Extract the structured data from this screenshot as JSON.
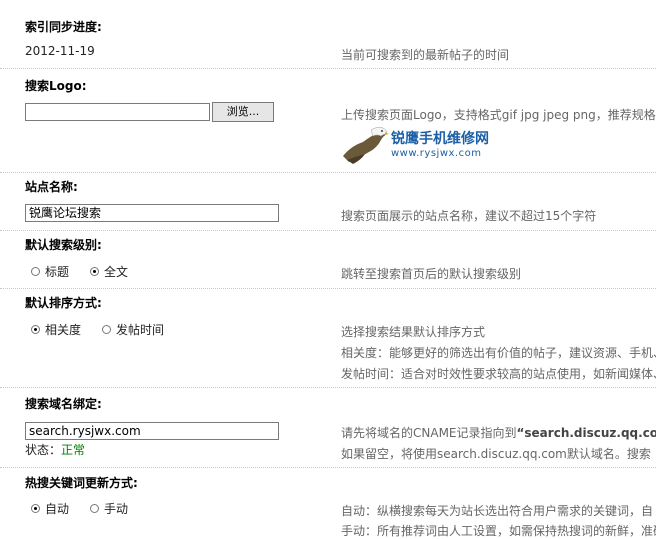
{
  "sync": {
    "title": "索引同步进度:",
    "value": "2012-11-19",
    "desc": "当前可搜索到的最新帖子的时间"
  },
  "logo": {
    "title": "搜索Logo:",
    "browse_label": "浏览...",
    "desc": "上传搜索页面Logo，支持格式gif jpg jpeg png，推荐规格",
    "logo_text": "锐鹰手机维修网",
    "logo_url": "www.rysjwx.com"
  },
  "site_name": {
    "title": "站点名称:",
    "value": "锐鹰论坛搜索",
    "desc": "搜索页面展示的站点名称，建议不超过15个字符"
  },
  "default_level": {
    "title": "默认搜索级别:",
    "options": [
      "标题",
      "全文"
    ],
    "selected": "全文",
    "desc": "跳转至搜索首页后的默认搜索级别"
  },
  "default_sort": {
    "title": "默认排序方式:",
    "options": [
      "相关度",
      "发帖时间"
    ],
    "selected": "相关度",
    "desc_lines": [
      "选择搜索结果默认排序方式",
      "相关度：能够更好的筛选出有价值的帖子，建议资源、手机、",
      "发帖时间：适合对时效性要求较高的站点使用，如新闻媒体、"
    ]
  },
  "domain_bind": {
    "title": "搜索域名绑定:",
    "value": "search.rysjwx.com",
    "status_label": "状态：",
    "status_value": "正常",
    "desc_line1_prefix": "请先将域名的CNAME记录指向到",
    "desc_line1_domain": "“search.discuz.qq.co",
    "desc_line2": "如果留空，将使用search.discuz.qq.com默认域名。搜索"
  },
  "hot_update": {
    "title": "热搜关键词更新方式:",
    "options": [
      "自动",
      "手动"
    ],
    "selected": "自动",
    "desc_lines": [
      "自动：纵横搜索每天为站长选出符合用户需求的关键词，自",
      "手动：所有推荐词由人工设置，如需保持热搜词的新鲜，准确"
    ]
  },
  "colors": {
    "border_dotted": "#c8c8c8",
    "desc_text": "#666666",
    "status_ok": "#008000",
    "logo_blue": "#1b5fa6"
  }
}
